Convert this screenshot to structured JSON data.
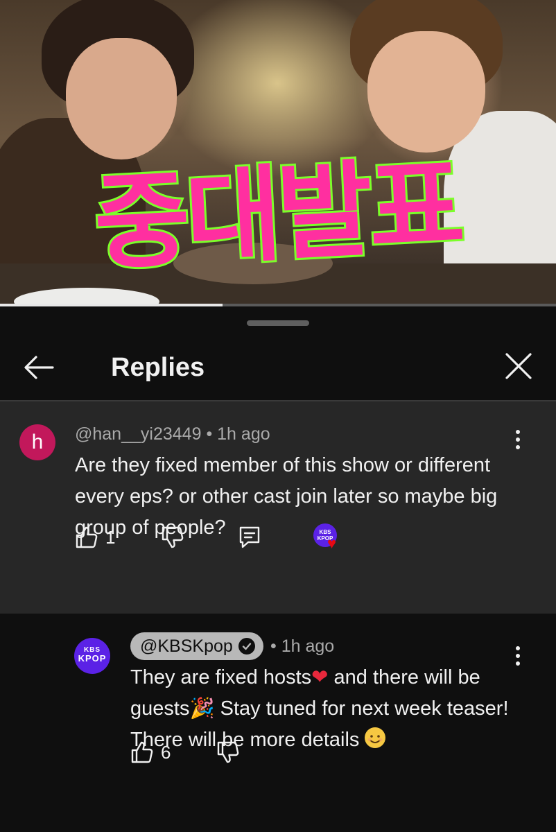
{
  "video": {
    "overlay_title": "중대발표",
    "progress_fraction": 0.4
  },
  "sheet": {
    "title": "Replies"
  },
  "parent_comment": {
    "avatar_letter": "h",
    "author": "@han__yi23449",
    "separator": "•",
    "time": "1h ago",
    "text": "Are they fixed member of this show or different every eps? or other cast join later so maybe big group of people?",
    "like_count": "1",
    "creator_heart_avatar": {
      "line1": "KBS",
      "line2": "KPOP"
    }
  },
  "reply": {
    "avatar": {
      "line1": "KBS",
      "line2": "KPOP"
    },
    "author": "@KBSKpop",
    "separator": "•",
    "time": "1h ago",
    "text_part1": "They are fixed hosts",
    "text_part2": " and there will be guests",
    "text_part3": " Stay tuned for next week teaser! There will be more details ",
    "emoji_heart": "❤",
    "emoji_party": "🎉",
    "like_count": "6"
  },
  "icons": {
    "back": "arrow-left-icon",
    "close": "close-icon",
    "more": "more-vert-icon",
    "like": "thumb-up-icon",
    "dislike": "thumb-down-icon",
    "reply": "reply-comment-icon",
    "verified": "verified-check-icon",
    "heart": "creator-heart-icon"
  },
  "colors": {
    "background": "#0f0f0f",
    "parent_comment_bg": "#272727",
    "avatar_h": "#c2185b",
    "kbs_purple": "#5b22e6",
    "heart_red": "#e50914",
    "overlay_pink": "#ff2fa0",
    "overlay_outline": "#7bff29"
  }
}
